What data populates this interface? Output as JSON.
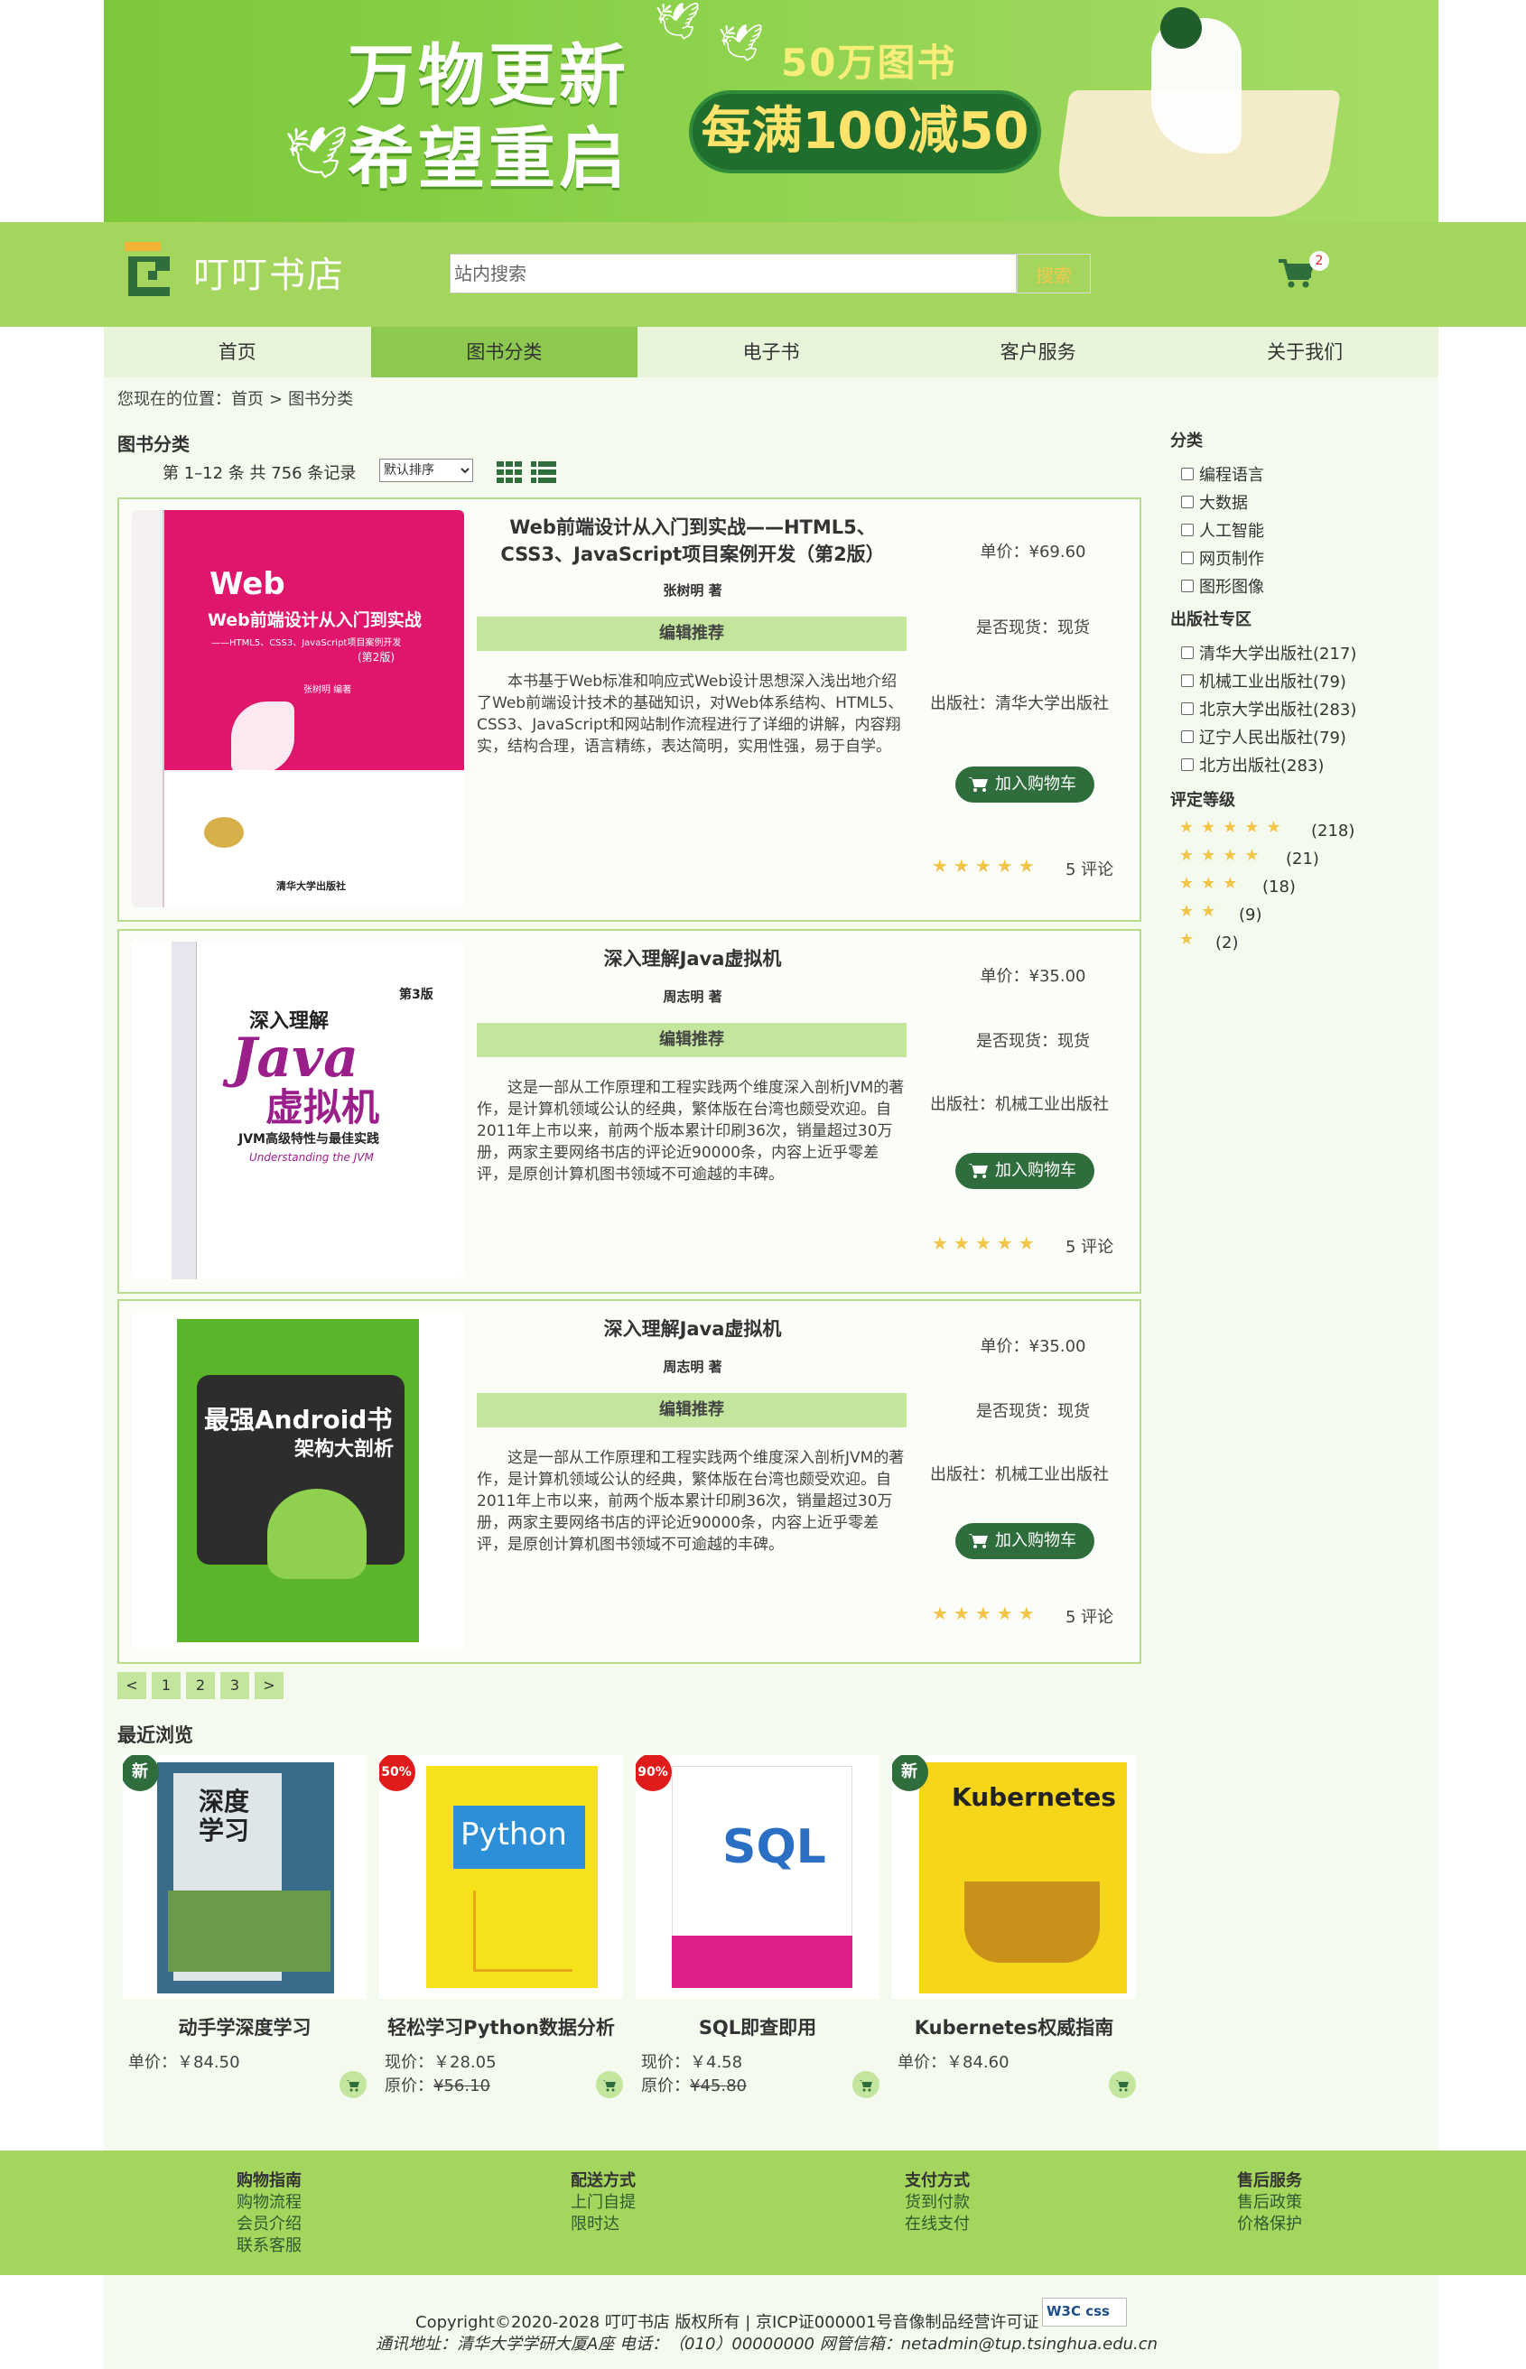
{
  "banner": {
    "line1": "万物更新",
    "line2": "希望重启",
    "books": "50万图书",
    "offer": "每满100减50"
  },
  "header": {
    "logo": "叮叮书店",
    "search_placeholder": "站内搜索",
    "search_button": "搜索",
    "cart_count": "2"
  },
  "nav": [
    "首页",
    "图书分类",
    "电子书",
    "客户服务",
    "关于我们"
  ],
  "breadcrumb": {
    "prefix": "您现在的位置：",
    "home": "首页",
    "sep": ">",
    "current": "图书分类"
  },
  "list": {
    "heading": "图书分类",
    "records": "第 1–12 条 共 756 条记录",
    "sort": "默认排序"
  },
  "books": [
    {
      "title": "Web前端设计从入门到实战——HTML5、CSS3、JavaScript项目案例开发（第2版）",
      "author": "张树明 著",
      "recommend": "编辑推荐",
      "desc": "本书基于Web标准和响应式Web设计思想深入浅出地介绍了Web前端设计技术的基础知识，对Web体系结构、HTML5、CSS3、JavaScript和网站制作流程进行了详细的讲解，内容翔实，结构合理，语言精练，表达简明，实用性强，易于自学。",
      "price": "单价：¥69.60",
      "stock": "是否现货：现货",
      "publisher": "出版社：清华大学出版社",
      "add": "加入购物车",
      "reviews": "5 评论",
      "cover_title": "Web前端设计从入门到实战",
      "cover_sub": "——HTML5、CSS3、JavaScript项目案例开发",
      "cover_edition": "(第2版)",
      "cover_author": "张树明 编著",
      "cover_press": "清华大学出版社"
    },
    {
      "title": "深入理解Java虚拟机",
      "author": "周志明 著",
      "recommend": "编辑推荐",
      "desc": "这是一部从工作原理和工程实践两个维度深入剖析JVM的著作，是计算机领域公认的经典，繁体版在台湾也颇受欢迎。自2011年上市以来，前两个版本累计印刷36次，销量超过30万册，两家主要网络书店的评论近90000条，内容上近乎零差评，是原创计算机图书领域不可逾越的丰碑。",
      "price": "单价：¥35.00",
      "stock": "是否现货：现货",
      "publisher": "出版社：机械工业出版社",
      "add": "加入购物车",
      "reviews": "5 评论",
      "cover_title": "深入理解",
      "cover_main1": "Java",
      "cover_main2": "虚拟机",
      "cover_sub": "JVM高级特性与最佳实践",
      "cover_edition": "第3版",
      "cover_en": "Understanding the JVM"
    },
    {
      "title": "深入理解Java虚拟机",
      "author": "周志明 著",
      "recommend": "编辑推荐",
      "desc": "这是一部从工作原理和工程实践两个维度深入剖析JVM的著作，是计算机领域公认的经典，繁体版在台湾也颇受欢迎。自2011年上市以来，前两个版本累计印刷36次，销量超过30万册，两家主要网络书店的评论近90000条，内容上近乎零差评，是原创计算机图书领域不可逾越的丰碑。",
      "price": "单价：¥35.00",
      "stock": "是否现货：现货",
      "publisher": "出版社：机械工业出版社",
      "add": "加入购物车",
      "reviews": "5 评论",
      "cover_title": "最强Android书",
      "cover_sub": "架构大剖析"
    }
  ],
  "pager": [
    "<",
    "1",
    "2",
    "3",
    ">"
  ],
  "recent": {
    "heading": "最近浏览",
    "items": [
      {
        "tag": "新",
        "tag_color": "#2f6e3c",
        "name": "动手学深度学习",
        "p1": "单价：￥84.50",
        "p2_label": "",
        "p2": "",
        "cover_text": "深度学习",
        "cover_color": "#3b6b8a"
      },
      {
        "tag": "50%",
        "tag_color": "#e01b1b",
        "name": "轻松学习Python数据分析",
        "p1": "现价：￥28.05",
        "p2_label": "原价：",
        "p2": "¥56.10",
        "cover_text": "Python",
        "cover_color": "#f5e21b"
      },
      {
        "tag": "90%",
        "tag_color": "#e01b1b",
        "name": "SQL即查即用",
        "p1": "现价：￥4.58",
        "p2_label": "原价：",
        "p2": "¥45.80",
        "cover_text": "SQL",
        "cover_color": "#ffffff"
      },
      {
        "tag": "新",
        "tag_color": "#2f6e3c",
        "name": "Kubernetes权威指南",
        "p1": "单价：￥84.60",
        "p2_label": "",
        "p2": "",
        "cover_text": "Kubernetes",
        "cover_color": "#f5d61b"
      }
    ]
  },
  "sidebar": {
    "category_h": "分类",
    "categories": [
      "编程语言",
      "大数据",
      "人工智能",
      "网页制作",
      "图形图像"
    ],
    "publisher_h": "出版社专区",
    "publishers": [
      "清华大学出版社(217)",
      "机械工业出版社(79)",
      "北京大学出版社(283)",
      "辽宁人民出版社(79)",
      "北方出版社(283)"
    ],
    "rating_h": "评定等级",
    "ratings": [
      {
        "stars": "★★★★★",
        "count": "(218)"
      },
      {
        "stars": "★★★★",
        "count": "(21)"
      },
      {
        "stars": "★★★",
        "count": "(18)"
      },
      {
        "stars": "★★",
        "count": "(9)"
      },
      {
        "stars": "★",
        "count": "(2)"
      }
    ]
  },
  "footer": {
    "cols": [
      {
        "h": "购物指南",
        "items": [
          "购物流程",
          "会员介绍",
          "联系客服"
        ]
      },
      {
        "h": "配送方式",
        "items": [
          "上门自提",
          "限时达"
        ]
      },
      {
        "h": "支付方式",
        "items": [
          "货到付款",
          "在线支付"
        ]
      },
      {
        "h": "售后服务",
        "items": [
          "售后政策",
          "价格保护"
        ]
      }
    ],
    "copyright": "Copyright©2020-2028 叮叮书店 版权所有 | 京ICP证000001号音像制品经营许可证",
    "address": "通讯地址：清华大学学研大厦A座  电话：（010）00000000  网管信箱：netadmin@tup.tsinghua.edu.cn",
    "badge": "W3C css"
  }
}
